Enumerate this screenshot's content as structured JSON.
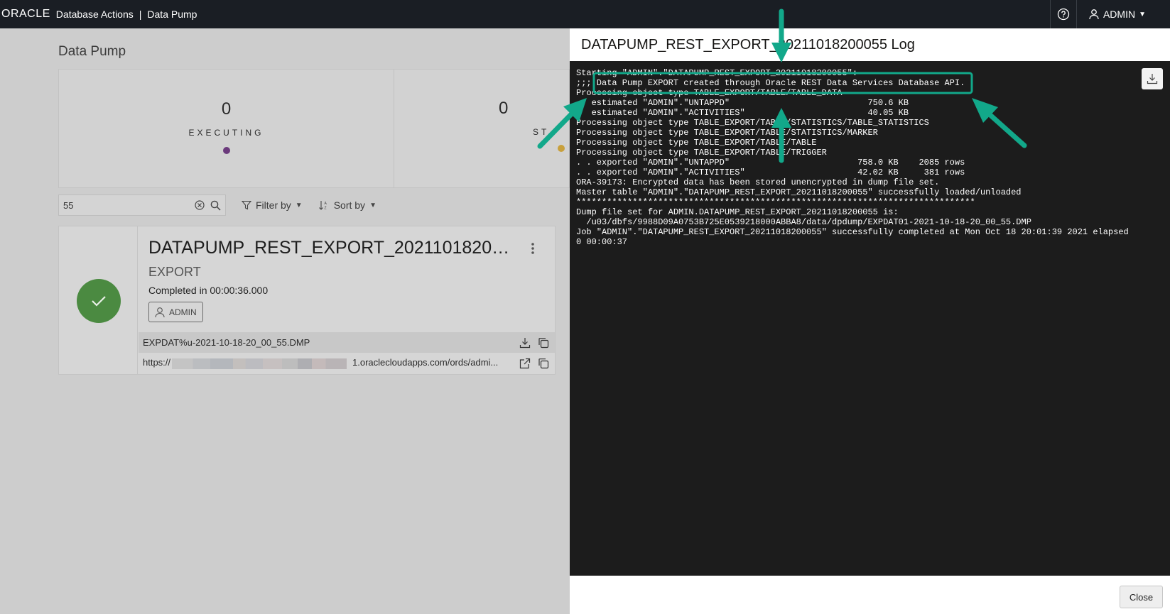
{
  "header": {
    "logo": "ORACLE",
    "app_title": "Database Actions",
    "separator": "|",
    "page": "Data Pump",
    "user": "ADMIN"
  },
  "page": {
    "title": "Data Pump",
    "stats": [
      {
        "count": "0",
        "label": "EXECUTING",
        "dot_color": "#6b3a7c"
      },
      {
        "count": "0",
        "label": "ST",
        "dot_color": "#c8a03c"
      }
    ],
    "search": {
      "value": "55"
    },
    "filter_label": "Filter by",
    "sort_label": "Sort by"
  },
  "job": {
    "name": "DATAPUMP_REST_EXPORT_20211018200055",
    "type": "EXPORT",
    "completed": "Completed in 00:00:36.000",
    "owner": "ADMIN",
    "dump_file": "EXPDAT%u-2021-10-18-20_00_55.DMP",
    "url_prefix": "https://",
    "url_suffix": "1.oraclecloudapps.com/ords/admi..."
  },
  "drawer": {
    "title": "DATAPUMP_REST_EXPORT_20211018200055 Log",
    "log": "Starting \"ADMIN\".\"DATAPUMP_REST_EXPORT_20211018200055\":\n;;; Data Pump EXPORT created through Oracle REST Data Services Database API.\nProcessing object type TABLE_EXPORT/TABLE/TABLE_DATA\n   estimated \"ADMIN\".\"UNTAPPD\"                           750.6 KB\n   estimated \"ADMIN\".\"ACTIVITIES\"                        40.05 KB\nProcessing object type TABLE_EXPORT/TABLE/STATISTICS/TABLE_STATISTICS\nProcessing object type TABLE_EXPORT/TABLE/STATISTICS/MARKER\nProcessing object type TABLE_EXPORT/TABLE/TABLE\nProcessing object type TABLE_EXPORT/TABLE/TRIGGER\n. . exported \"ADMIN\".\"UNTAPPD\"                         758.0 KB    2085 rows\n. . exported \"ADMIN\".\"ACTIVITIES\"                      42.02 KB     381 rows\nORA-39173: Encrypted data has been stored unencrypted in dump file set.\nMaster table \"ADMIN\".\"DATAPUMP_REST_EXPORT_20211018200055\" successfully loaded/unloaded\n******************************************************************************\nDump file set for ADMIN.DATAPUMP_REST_EXPORT_20211018200055 is:\n  /u03/dbfs/9988D09A0753B725E0539218000ABBA8/data/dpdump/EXPDAT01-2021-10-18-20_00_55.DMP\nJob \"ADMIN\".\"DATAPUMP_REST_EXPORT_20211018200055\" successfully completed at Mon Oct 18 20:01:39 2021 elapsed\n0 00:00:37",
    "close_label": "Close"
  },
  "colors": {
    "annotation": "#12a88a",
    "success": "#4b8a41"
  }
}
